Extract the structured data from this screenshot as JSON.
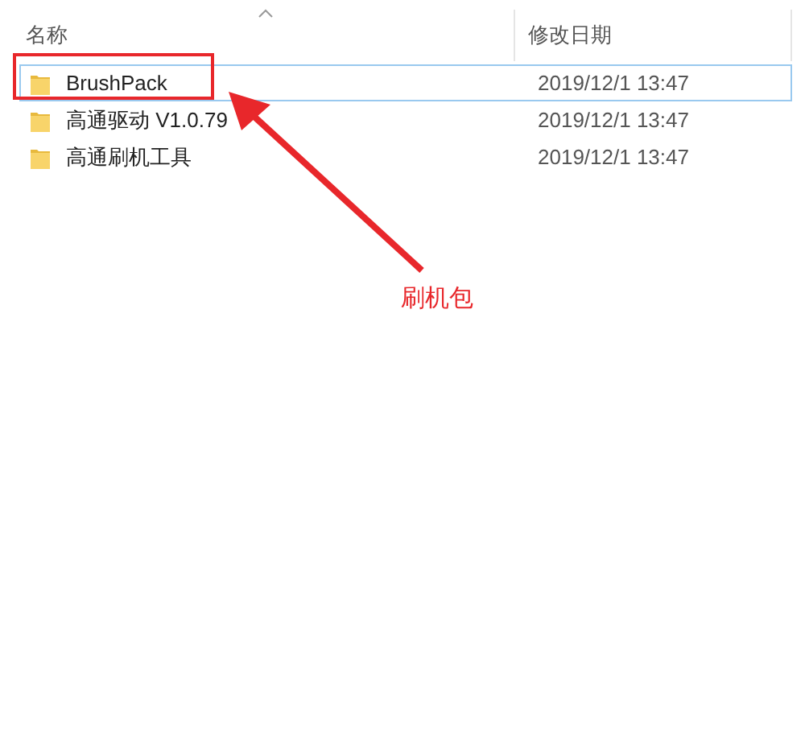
{
  "columns": [
    "名称",
    "修改日期"
  ],
  "rows": [
    {
      "name": "BrushPack",
      "date": "2019/12/1 13:47",
      "selected": true,
      "highlighted": true
    },
    {
      "name": "高通驱动 V1.0.79",
      "date": "2019/12/1 13:47",
      "selected": false,
      "highlighted": false
    },
    {
      "name": "高通刷机工具",
      "date": "2019/12/1 13:47",
      "selected": false,
      "highlighted": false
    }
  ],
  "annotation": {
    "label": "刷机包"
  }
}
